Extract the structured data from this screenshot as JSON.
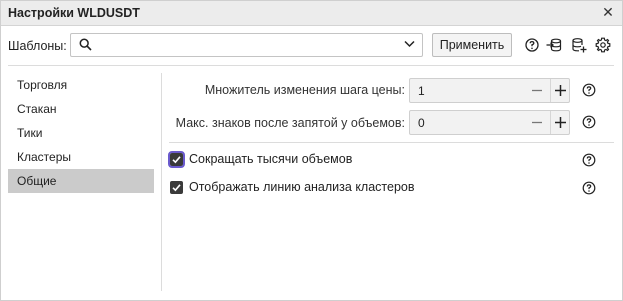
{
  "window": {
    "title": "Настройки WLDUSDT"
  },
  "toolbar": {
    "templates_label": "Шаблоны:",
    "search_value": "",
    "apply_label": "Применить"
  },
  "sidebar": {
    "items": [
      {
        "label": "Торговля",
        "active": false
      },
      {
        "label": "Стакан",
        "active": false
      },
      {
        "label": "Тики",
        "active": false
      },
      {
        "label": "Кластеры",
        "active": false
      },
      {
        "label": "Общие",
        "active": true
      }
    ]
  },
  "settings": {
    "price_step_multiplier": {
      "label": "Множитель изменения шага цены:",
      "value": "1"
    },
    "volume_decimals": {
      "label": "Макс. знаков после запятой у объемов:",
      "value": "0"
    },
    "shorten_thousands": {
      "label": "Сокращать тысячи объемов",
      "checked": true
    },
    "show_cluster_line": {
      "label": "Отображать линию анализа кластеров",
      "checked": true
    }
  }
}
